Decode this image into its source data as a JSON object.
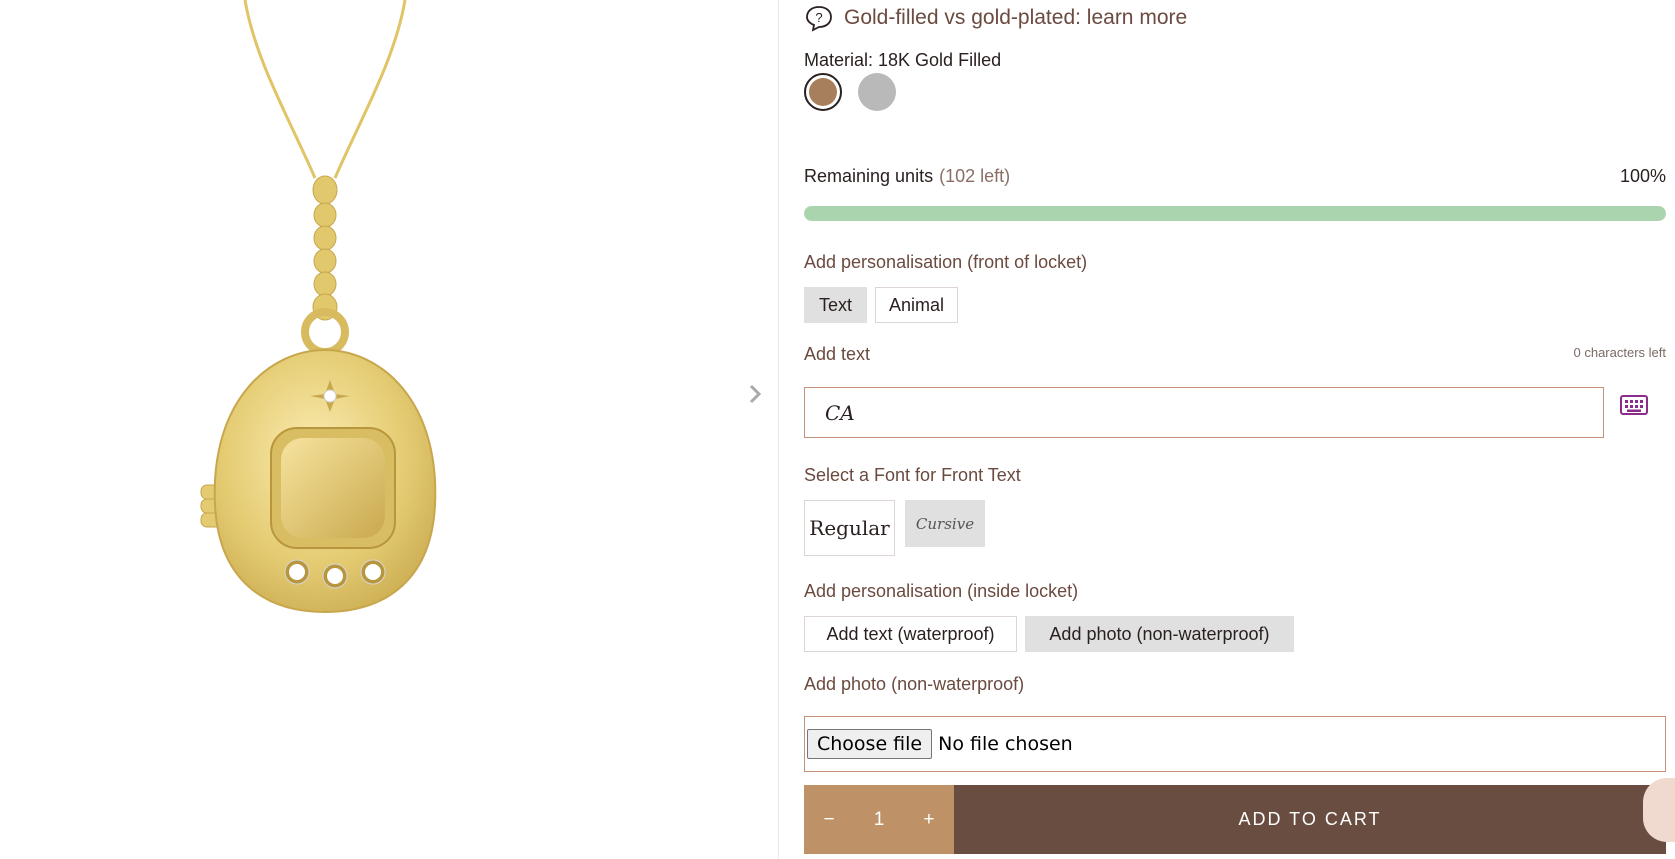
{
  "help": {
    "text": "Gold-filled vs gold-plated: learn more",
    "icon": "question-bubble-icon"
  },
  "material": {
    "label": "Material: 18K Gold Filled",
    "options": [
      {
        "name": "18K Gold Filled",
        "color": "#a77f5c"
      },
      {
        "name": "Silver",
        "color": "#b9b9b9"
      }
    ]
  },
  "inventory": {
    "label": "Remaining units",
    "left": "(102 left)",
    "percent": "100%",
    "fill": 1.0,
    "bar_color": "#a9d4ad"
  },
  "front": {
    "label": "Add personalisation (front of locket)",
    "options": [
      "Text",
      "Animal"
    ],
    "selected": "Text",
    "text_label": "Add text",
    "chars_left": "0 characters left",
    "text_value": "CA",
    "font_label": "Select a Font for Front Text",
    "fonts": [
      "Regular",
      "Cursive"
    ],
    "selected_font": "Cursive"
  },
  "inside": {
    "label": "Add personalisation (inside locket)",
    "options": [
      "Add text (waterproof)",
      "Add photo (non-waterproof)"
    ],
    "selected": "Add photo (non-waterproof)",
    "photo_label": "Add photo (non-waterproof)",
    "file_button": "Choose file",
    "file_status": "No file chosen"
  },
  "cart": {
    "minus": "−",
    "quantity": "1",
    "plus": "+",
    "button": "ADD TO CART"
  },
  "colors": {
    "brand_dark": "#694d40",
    "brand_tan": "#bf9167",
    "text_brown": "#6b4a3f",
    "input_border": "#c2927a",
    "gold": "#e6cf78"
  }
}
